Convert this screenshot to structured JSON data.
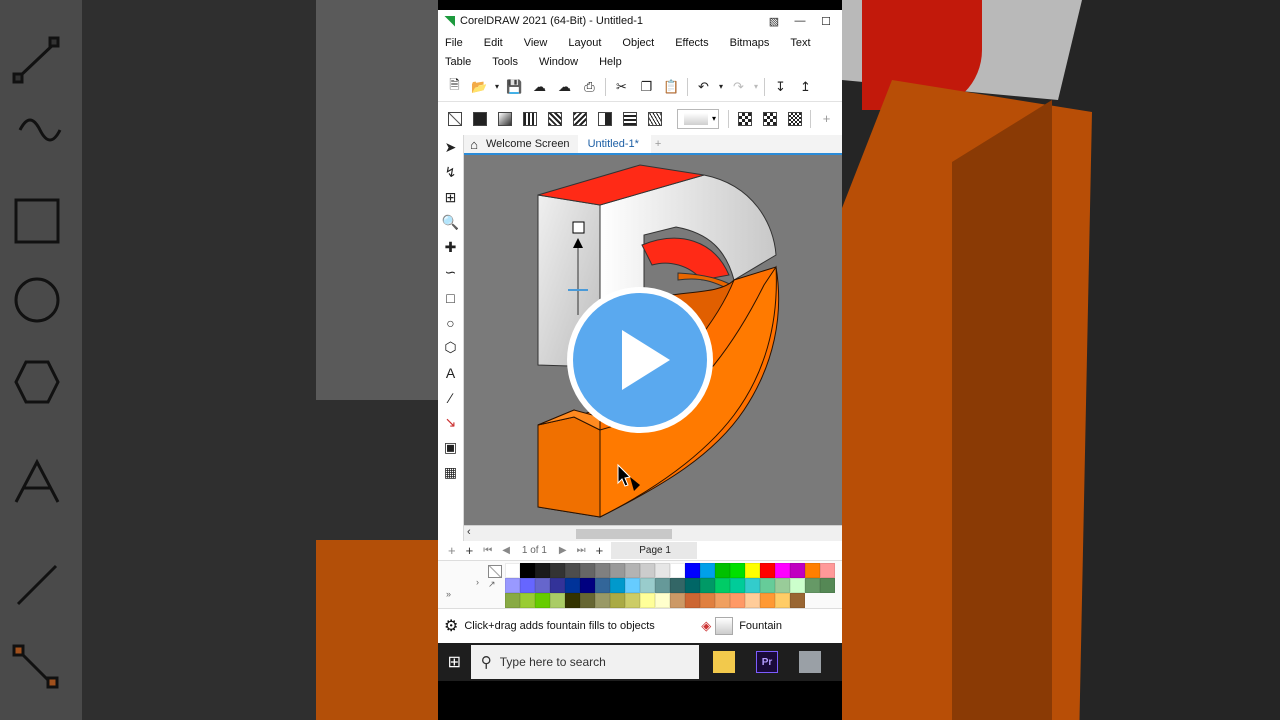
{
  "window": {
    "title": "CorelDRAW 2021 (64-Bit) - Untitled-1"
  },
  "menu": {
    "items": [
      "File",
      "Edit",
      "View",
      "Layout",
      "Object",
      "Effects",
      "Bitmaps",
      "Text",
      "Table",
      "Tools",
      "Window",
      "Help"
    ]
  },
  "tabs": {
    "welcome": "Welcome Screen",
    "document": "Untitled-1*"
  },
  "pagenav": {
    "page_of": "1 of 1",
    "page_tab": "Page 1"
  },
  "palette": {
    "colors": [
      "#ffffff",
      "#000000",
      "#1a1a1a",
      "#333333",
      "#4d4d4d",
      "#666666",
      "#808080",
      "#999999",
      "#b3b3b3",
      "#cccccc",
      "#e6e6e6",
      "#ffffff",
      "#0000ff",
      "#00a0e9",
      "#00c000",
      "#00e000",
      "#ffff00",
      "#ff0000",
      "#ff00ff",
      "#c000c0",
      "#ff7f00",
      "#ff9999",
      "#9999ff",
      "#6666ff",
      "#6666cc",
      "#333399",
      "#003399",
      "#000080",
      "#336699",
      "#0099cc",
      "#66ccff",
      "#99cccc",
      "#669999",
      "#336666",
      "#006666",
      "#009966",
      "#00cc66",
      "#00cc99",
      "#33cccc",
      "#66cc99",
      "#99cc99",
      "#ccffcc",
      "#669966",
      "#558855",
      "#88aa44",
      "#99cc33",
      "#66cc00",
      "#aacc66",
      "#333300",
      "#666633",
      "#999966",
      "#aaaa44",
      "#cccc66",
      "#ffff99",
      "#ffffcc",
      "#cc9966",
      "#cc6633",
      "#e08040",
      "#f0a060",
      "#ff9966",
      "#ffcc99",
      "#ff9933",
      "#ffcc66",
      "#996633"
    ]
  },
  "status": {
    "hint": "Click+drag adds fountain fills to objects",
    "fill_label": "Fountain"
  },
  "taskbar": {
    "search_placeholder": "Type here to search",
    "premiere_label": "Pr"
  }
}
